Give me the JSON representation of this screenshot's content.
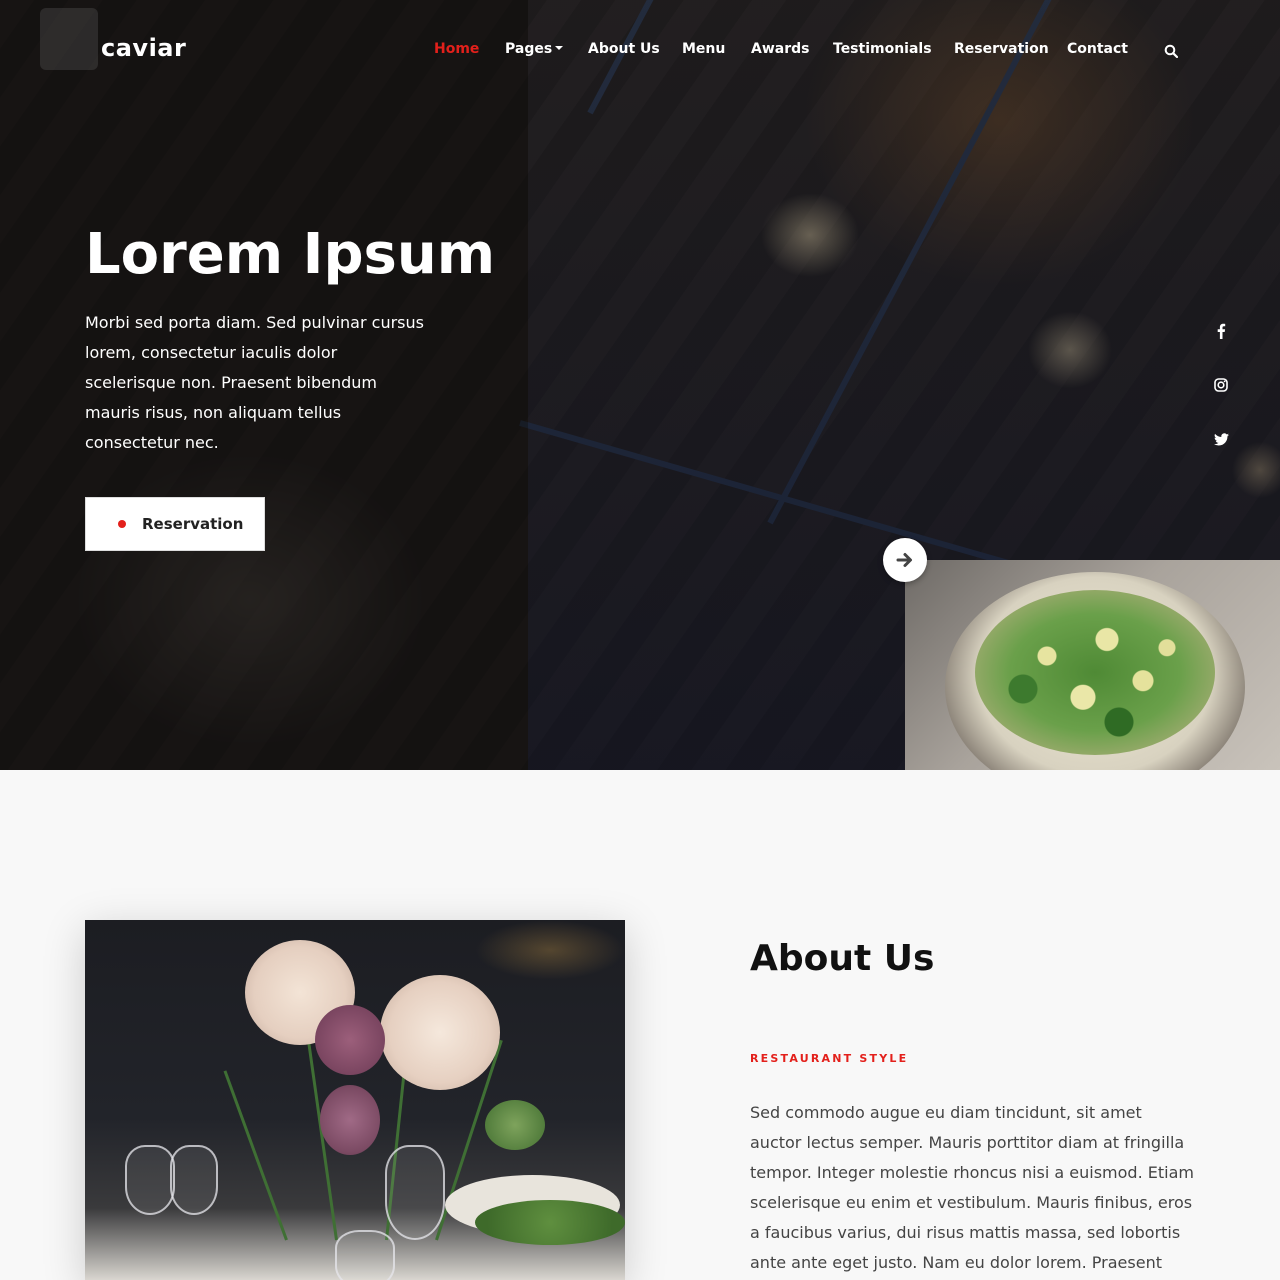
{
  "brand": "caviar",
  "nav": {
    "items": [
      {
        "label": "Home"
      },
      {
        "label": "Pages"
      },
      {
        "label": "About Us"
      },
      {
        "label": "Menu"
      },
      {
        "label": "Awards"
      },
      {
        "label": "Testimonials"
      },
      {
        "label": "Reservation"
      },
      {
        "label": "Contact"
      }
    ],
    "active": "Home",
    "search_icon": "search-icon"
  },
  "hero": {
    "title": "Lorem Ipsum",
    "text": "Morbi sed porta diam. Sed pulvinar cursus lorem, consectetur iaculis dolor scelerisque non. Praesent bibendum mauris risus, non aliquam tellus consectetur nec.",
    "button_label": "Reservation",
    "next_icon": "arrow-right-icon"
  },
  "social": [
    "facebook-icon",
    "instagram-icon",
    "twitter-icon"
  ],
  "about": {
    "title": "About Us",
    "subtitle": "RESTAURANT STYLE",
    "text": "Sed commodo augue eu diam tincidunt, sit amet auctor lectus semper. Mauris porttitor diam at fringilla tempor. Integer molestie rhoncus nisi a euismod. Etiam scelerisque eu enim et vestibulum. Mauris finibus, eros a faucibus varius, dui risus mattis massa, sed lobortis ante ante eget justo. Nam eu dolor lorem. Praesent blandit leo sit amet"
  },
  "colors": {
    "accent": "#e3201b",
    "text_dark": "#111111",
    "background": "#f8f8f8"
  }
}
